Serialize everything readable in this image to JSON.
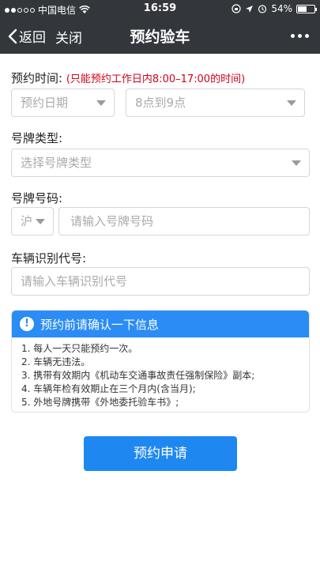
{
  "status_bar": {
    "carrier": "中国电信",
    "time": "16:59",
    "battery_pct": "54%",
    "battery_level": 0.54
  },
  "nav": {
    "back_label": "返回",
    "close_label": "关闭",
    "title": "预约验车"
  },
  "form": {
    "appointment_time": {
      "label": "预约时间:",
      "hint": "(只能预约工作日内8:00–17:00的时间)",
      "date_placeholder": "预约日期",
      "time_value": "8点到9点"
    },
    "plate_type": {
      "label": "号牌类型:",
      "placeholder": "选择号牌类型"
    },
    "plate_number": {
      "label": "号牌号码:",
      "prefix": "沪",
      "placeholder": "请输入号牌号码"
    },
    "vin": {
      "label": "车辆识别代号:",
      "placeholder": "请输入车辆识别代号"
    }
  },
  "notice": {
    "title": "预约前请确认一下信息",
    "icon": "!",
    "items": [
      "1. 每人一天只能预约一次。",
      "2. 车辆无违法。",
      "3. 携带有效期内《机动车交通事故责任强制保险》副本;",
      "4. 车辆年检有效期止在三个月内(含当月);",
      "5. 外地号牌携带《外地委托验车书》;"
    ]
  },
  "submit_label": "预约申请",
  "colors": {
    "header_bg": "#33373c",
    "accent": "#1e88f0",
    "hint": "#d0021b"
  }
}
